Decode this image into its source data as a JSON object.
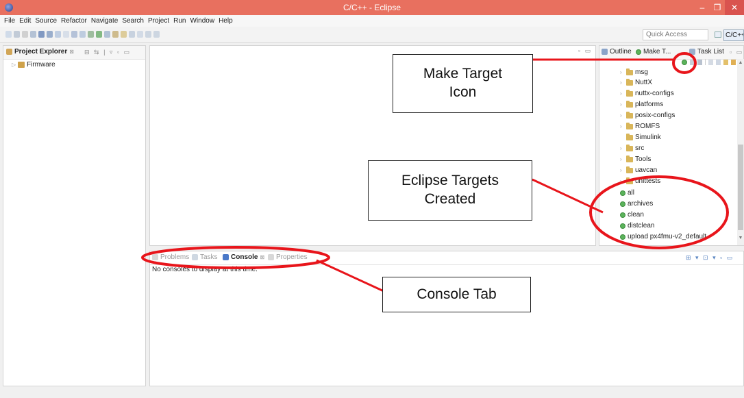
{
  "window": {
    "title": "C/C++ - Eclipse",
    "minimize": "–",
    "maximize": "❐",
    "close": "✕"
  },
  "menu": [
    "File",
    "Edit",
    "Source",
    "Refactor",
    "Navigate",
    "Search",
    "Project",
    "Run",
    "Window",
    "Help"
  ],
  "toolbar": {
    "quick_access_placeholder": "Quick Access",
    "perspective": "C/C++"
  },
  "project_explorer": {
    "tab": "Project Explorer",
    "close": "⊠",
    "controls": "⊟ ⇆ | ▿ ▫ ▭",
    "items": [
      {
        "label": "Firmware",
        "expanded": false
      }
    ]
  },
  "editor": {
    "controls": "▫ ▭"
  },
  "right_panel": {
    "tabs": {
      "outline": "Outline",
      "make_target": "Make T...",
      "task_list": "Task List"
    },
    "controls": "▫ ▭",
    "folders": [
      "msg",
      "NuttX",
      "nuttx-configs",
      "platforms",
      "posix-configs",
      "ROMFS",
      "Simulink",
      "src",
      "Tools",
      "uavcan",
      "unittests"
    ],
    "targets": [
      "all",
      "archives",
      "clean",
      "distclean",
      "upload px4fmu-v2_default"
    ]
  },
  "console": {
    "tabs": {
      "problems": "Problems",
      "tasks": "Tasks",
      "console": "Console",
      "properties": "Properties"
    },
    "message": "No consoles to display at this time.",
    "controls": "⊞ ▾ ⊡ ▾ ▫ ▭"
  },
  "annotations": {
    "make_target_icon": "Make Target\nIcon",
    "eclipse_targets": "Eclipse Targets\nCreated",
    "console_tab": "Console Tab",
    "color": "#e8151b"
  }
}
